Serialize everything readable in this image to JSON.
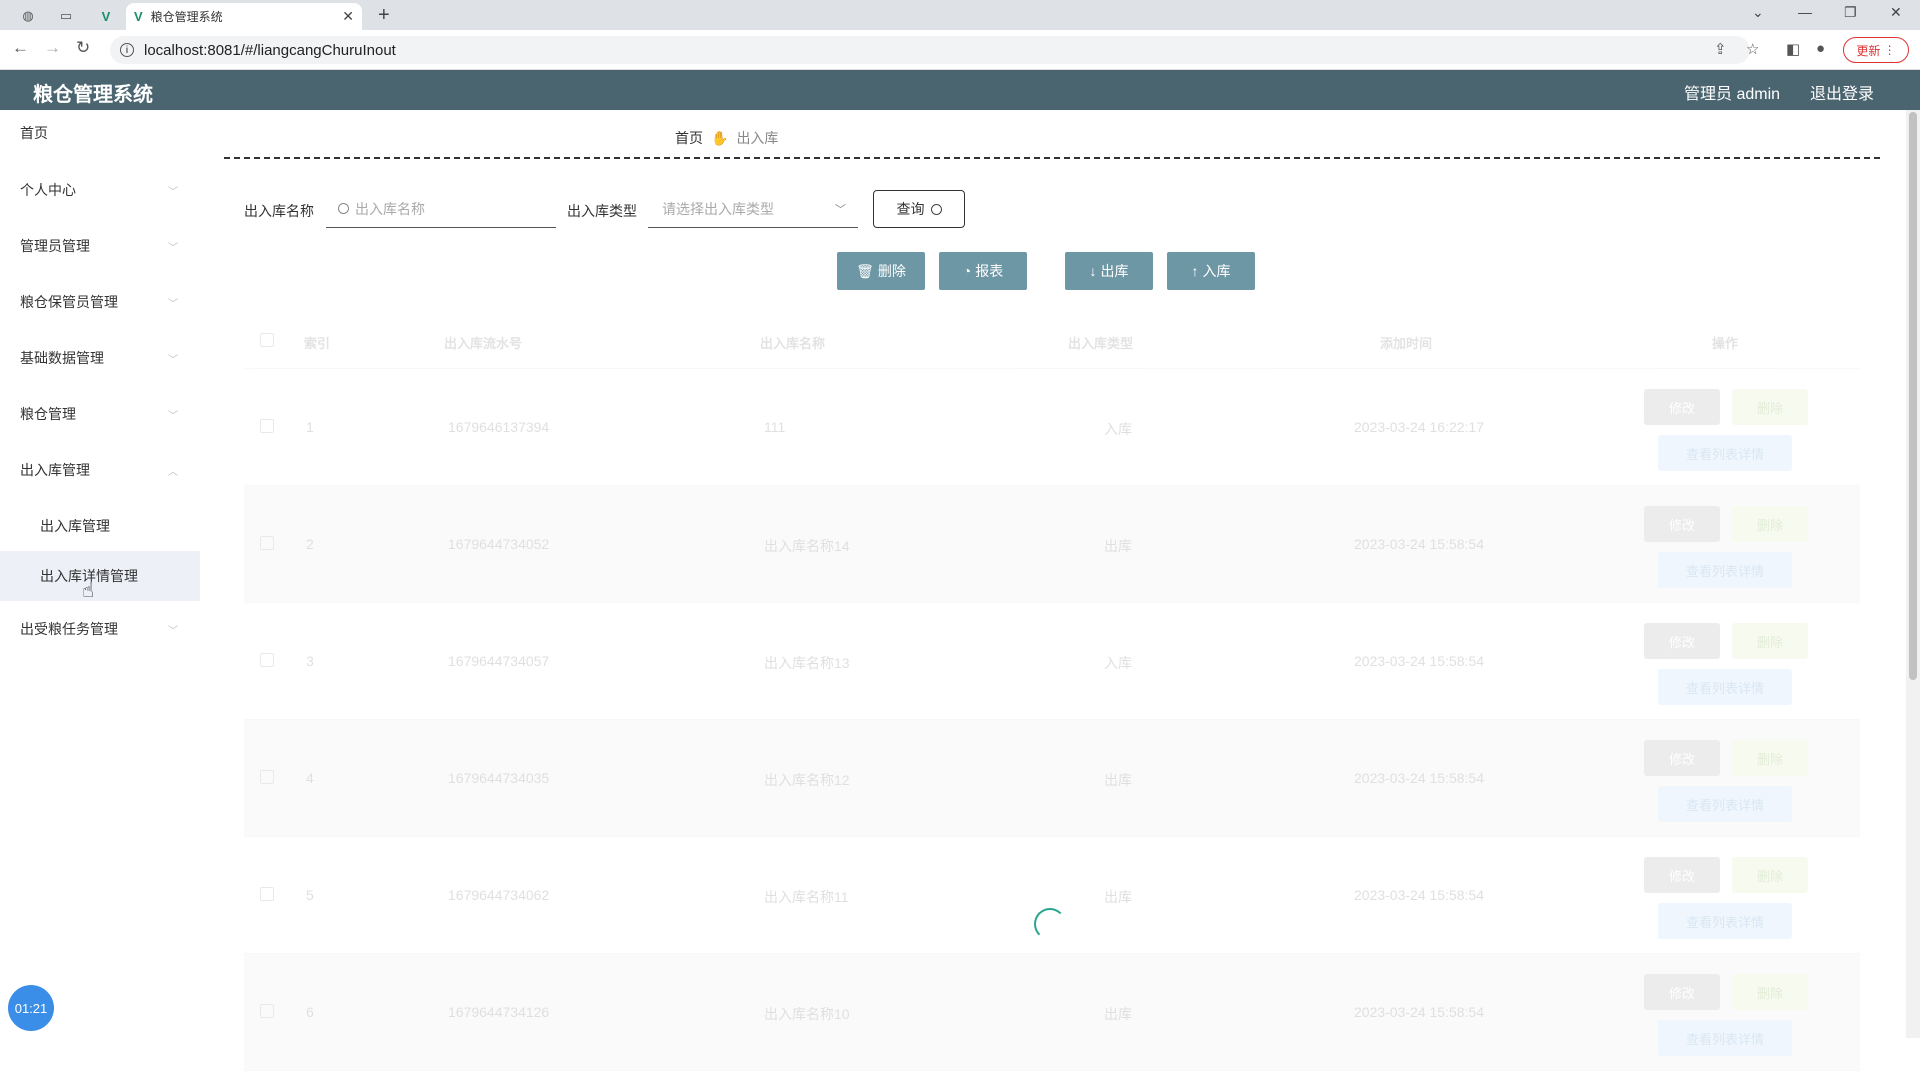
{
  "browser": {
    "tab_title": "粮仓管理系统",
    "url": "localhost:8081/#/liangcangChuruInout",
    "update_label": "更新"
  },
  "header": {
    "title": "粮仓管理系统",
    "user": "管理员 admin",
    "logout": "退出登录"
  },
  "sidebar": {
    "items": [
      {
        "label": "首页"
      },
      {
        "label": "个人中心"
      },
      {
        "label": "管理员管理"
      },
      {
        "label": "粮仓保管员管理"
      },
      {
        "label": "基础数据管理"
      },
      {
        "label": "粮仓管理"
      },
      {
        "label": "出入库管理"
      },
      {
        "label": "出受粮任务管理"
      }
    ],
    "subitems": [
      {
        "label": "出入库管理"
      },
      {
        "label": "出入库详情管理"
      }
    ]
  },
  "breadcrumb": {
    "home": "首页",
    "current": "出入库"
  },
  "search": {
    "name_label": "出入库名称",
    "name_placeholder": "出入库名称",
    "type_label": "出入库类型",
    "type_placeholder": "请选择出入库类型",
    "query_label": "查询"
  },
  "actions": {
    "delete": "删除",
    "report": "报表",
    "out": "出库",
    "in": "入库"
  },
  "table": {
    "headers": [
      "索引",
      "出入库流水号",
      "出入库名称",
      "出入库类型",
      "添加时间",
      "操作"
    ],
    "rows": [
      {
        "index": "1",
        "serial": "1679646137394",
        "name": "111",
        "type": "入库",
        "time": "2023-03-24 16:22:17"
      },
      {
        "index": "2",
        "serial": "1679644734052",
        "name": "出入库名称14",
        "type": "出库",
        "time": "2023-03-24 15:58:54"
      },
      {
        "index": "3",
        "serial": "1679644734057",
        "name": "出入库名称13",
        "type": "入库",
        "time": "2023-03-24 15:58:54"
      },
      {
        "index": "4",
        "serial": "1679644734035",
        "name": "出入库名称12",
        "type": "出库",
        "time": "2023-03-24 15:58:54"
      },
      {
        "index": "5",
        "serial": "1679644734062",
        "name": "出入库名称11",
        "type": "出库",
        "time": "2023-03-24 15:58:54"
      },
      {
        "index": "6",
        "serial": "1679644734126",
        "name": "出入库名称10",
        "type": "出库",
        "time": "2023-03-24 15:58:54"
      }
    ],
    "row_actions": {
      "modify": "修改",
      "delete": "删除",
      "view": "查看列表详情"
    }
  },
  "timer": "01:21"
}
